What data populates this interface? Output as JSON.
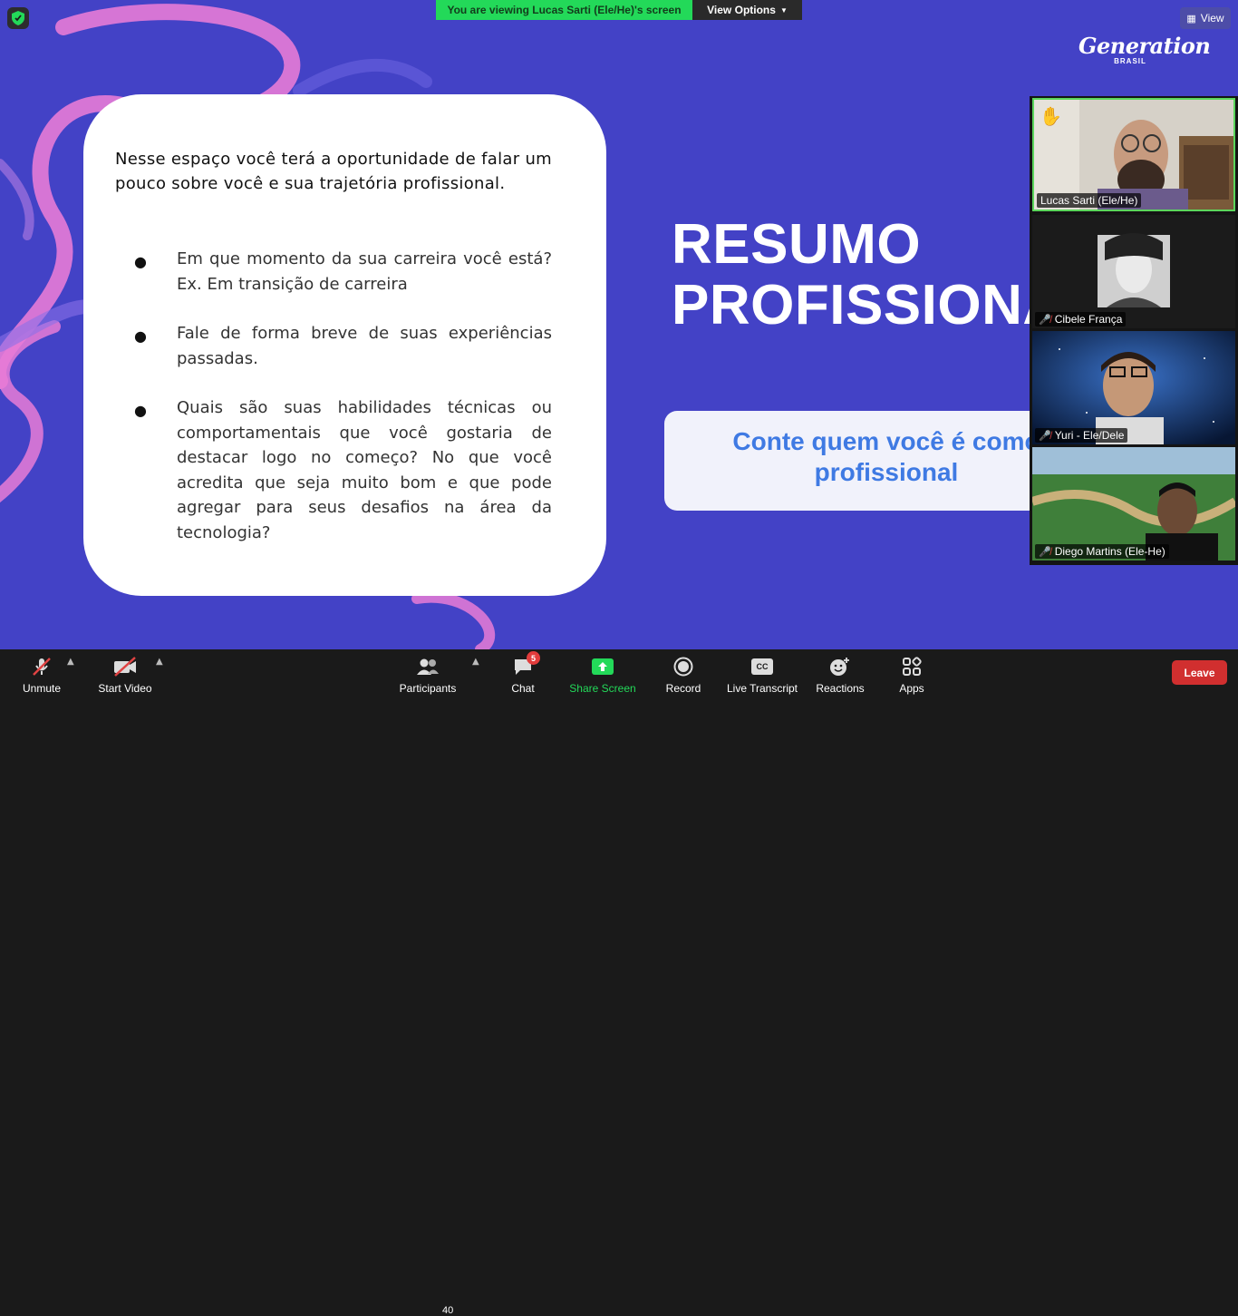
{
  "banner": {
    "viewing_text": "You are viewing Lucas Sarti (Ele/He)'s screen",
    "view_options_label": "View Options"
  },
  "view_button": {
    "label": "View"
  },
  "logo": {
    "main": "Generation",
    "sub": "BRASIL"
  },
  "slide": {
    "intro": "Nesse espaço você terá a oportunidade de falar um pouco sobre você e sua trajetória profissional.",
    "items": [
      "Em que momento da sua carreira você está? Ex. Em transição de carreira",
      "Fale de forma breve de suas experiências passadas.",
      "Quais são suas habilidades técnicas ou comportamentais que você gostaria de destacar logo no começo? No que você acredita que seja muito bom e que pode agregar para seus desafios na área da tecnologia?"
    ],
    "bullet": "●",
    "heading_line1": "RESUMO",
    "heading_line2": "PROFISSIONAL",
    "subtitle_line1": "Conte quem você é como",
    "subtitle_line2": "profissional"
  },
  "participants_tiles": [
    {
      "name": "Lucas Sarti (Ele/He)",
      "muted": false,
      "hand_raised": true
    },
    {
      "name": "Cibele França",
      "muted": true
    },
    {
      "name": "Yuri - Ele/Dele",
      "muted": true
    },
    {
      "name": "Diego Martins (Ele-He)",
      "muted": true
    }
  ],
  "toolbar": {
    "unmute": "Unmute",
    "start_video": "Start Video",
    "participants": "Participants",
    "participants_count": "40",
    "chat": "Chat",
    "chat_badge": "5",
    "share_screen": "Share Screen",
    "record": "Record",
    "live_transcript": "Live Transcript",
    "reactions": "Reactions",
    "apps": "Apps",
    "leave": "Leave",
    "cc_text": "CC"
  },
  "colors": {
    "slide_bg": "#4342c6",
    "banner_green": "#23d959",
    "subtitle_blue": "#3f7ae3",
    "leave_red": "#d12f2f",
    "squiggle_pink": "#e77bd6"
  }
}
